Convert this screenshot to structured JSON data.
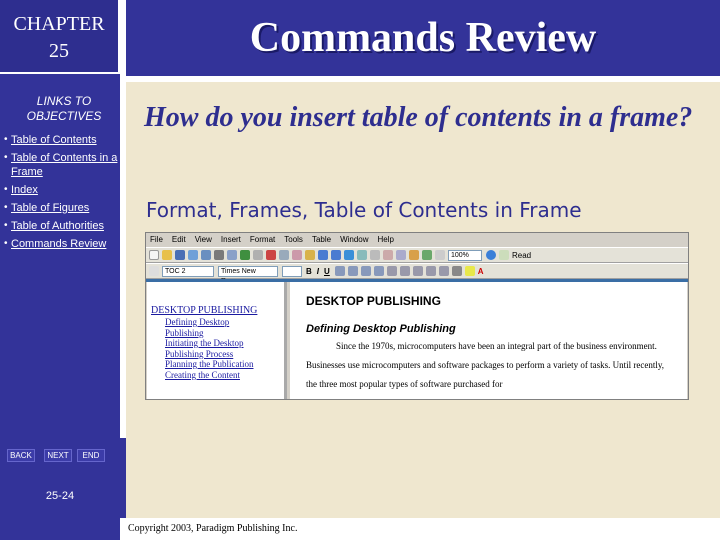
{
  "chapter": {
    "line1": "CHAPTER",
    "line2": "25"
  },
  "links": {
    "title_line1": "LINKS TO",
    "title_line2": "OBJECTIVES",
    "items": [
      "Table of Contents",
      "Table of Contents in a Frame",
      "Index",
      "Table of Figures",
      "Table of Authorities",
      "Commands Review"
    ]
  },
  "nav": {
    "back": "BACK",
    "next": "NEXT",
    "end": "END"
  },
  "slide_number": "25-24",
  "slide": {
    "title": "Commands Review",
    "question": "How do you insert table of contents in a frame?",
    "answer": "Format, Frames, Table of Contents in Frame"
  },
  "word": {
    "menu": [
      "File",
      "Edit",
      "View",
      "Insert",
      "Format",
      "Tools",
      "Table",
      "Window",
      "Help"
    ],
    "style_box": "TOC 2",
    "font_box": "Times New Roman",
    "zoom_box": "100%",
    "read_label": "Read",
    "toc": {
      "heading": "DESKTOP PUBLISHING",
      "items": [
        "Defining Desktop",
        "Publishing",
        "Initiating the Desktop",
        "Publishing Process",
        "Planning the Publication",
        "Creating the Content"
      ]
    },
    "doc": {
      "heading": "DESKTOP PUBLISHING",
      "subheading": "Defining Desktop Publishing",
      "paragraph": "Since the 1970s, microcomputers have been an integral part of the business environment. Businesses use microcomputers and software packages to perform a variety of tasks. Until recently, the three most popular types of software purchased for"
    }
  },
  "copyright": "Copyright 2003, Paradigm Publishing Inc.",
  "colors": {
    "navy": "#333399",
    "panel": "#efe7cf",
    "text_blue": "#2e2e8f"
  }
}
